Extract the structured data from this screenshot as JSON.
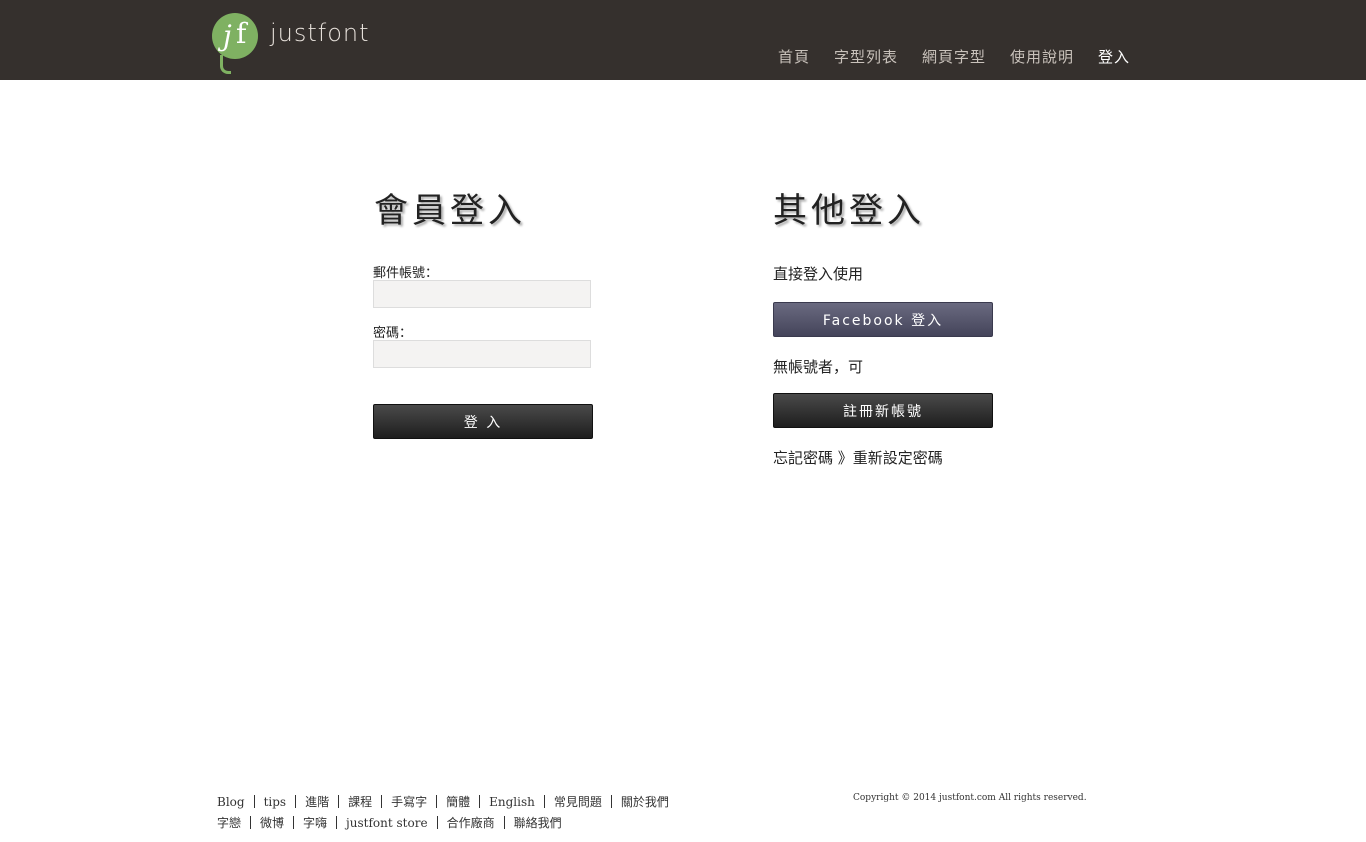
{
  "header": {
    "logo_text": "justfont",
    "nav": [
      {
        "label": "首頁"
      },
      {
        "label": "字型列表"
      },
      {
        "label": "網頁字型"
      },
      {
        "label": "使用說明"
      },
      {
        "label": "登入"
      }
    ]
  },
  "member_login": {
    "title": "會員登入",
    "email_label": "郵件帳號：",
    "email_value": "",
    "password_label": "密碼：",
    "password_value": "",
    "submit_label": "登 入"
  },
  "other_login": {
    "title": "其他登入",
    "direct_text": "直接登入使用",
    "facebook_button": "Facebook 登入",
    "no_account_text": "無帳號者，可",
    "register_button": "註冊新帳號",
    "forgot_text": "忘記密碼 》",
    "reset_link": "重新設定密碼"
  },
  "footer": {
    "row1": [
      "Blog",
      "tips",
      "進階",
      "課程",
      "手寫字",
      "簡體",
      "English",
      "常見問題",
      "關於我們"
    ],
    "row2": [
      "字戀",
      "微博",
      "字嗨",
      "justfont store",
      "合作廠商",
      "聯絡我們"
    ],
    "copyright": "Copyright © 2014 justfont.com All rights reserved."
  },
  "colors": {
    "topbar": "#35302d",
    "logo_green": "#7fb162",
    "facebook_button": "#55556b",
    "dark_button": "#2e2e2e"
  }
}
